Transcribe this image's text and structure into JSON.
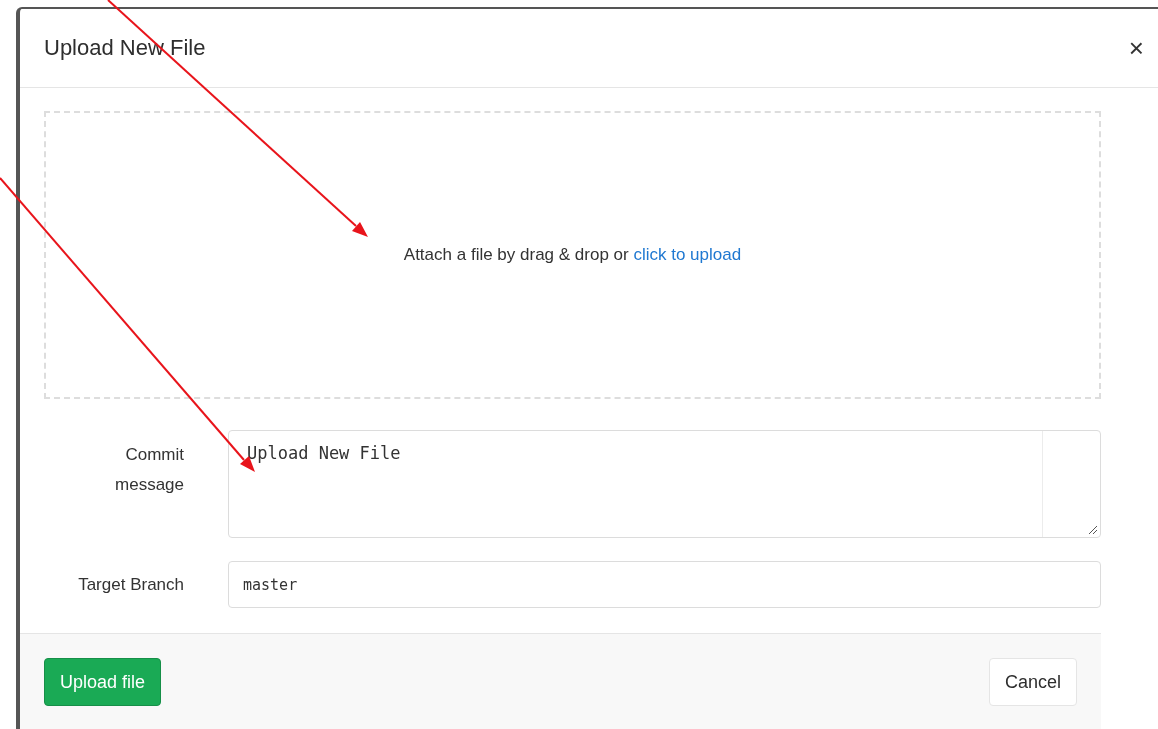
{
  "dialog": {
    "title": "Upload New File",
    "close": "×"
  },
  "dropzone": {
    "text": "Attach a file by drag & drop or ",
    "link": "click to upload"
  },
  "fields": [
    {
      "kind": "textarea",
      "label": "Commit message",
      "value": "Upload New File"
    },
    {
      "kind": "input",
      "label": "Target Branch",
      "value": "master"
    }
  ],
  "buttons": [
    {
      "label": "Upload file",
      "kind": "primary"
    },
    {
      "label": "Cancel",
      "kind": "default"
    }
  ]
}
